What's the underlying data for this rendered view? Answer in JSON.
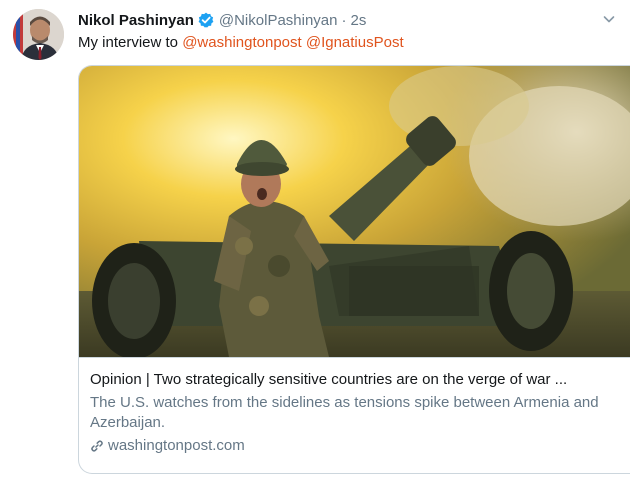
{
  "author": {
    "name": "Nikol Pashinyan",
    "handle": "@NikolPashinyan",
    "separator": "·",
    "time": "2s",
    "avatar_icon": "avatar-portrait",
    "verified_icon": "verified-badge-icon"
  },
  "tweet": {
    "prefix": "My interview to ",
    "mention_1": "@washingtonpost",
    "mention_2": "@IgnatiusPost"
  },
  "card": {
    "image_alt": "soldier firing artillery",
    "title": "Opinion | Two strategically sensitive countries are on the verge of war ...",
    "description": "The U.S. watches from the sidelines as tensions spike between Armenia and Azerbaijan.",
    "domain": "washingtonpost.com",
    "link_icon": "link-icon"
  },
  "colors": {
    "text": "#14171a",
    "muted": "#657786",
    "mention": "#e0541e",
    "verified": "#1da1f2",
    "border": "#ccd6dd"
  }
}
